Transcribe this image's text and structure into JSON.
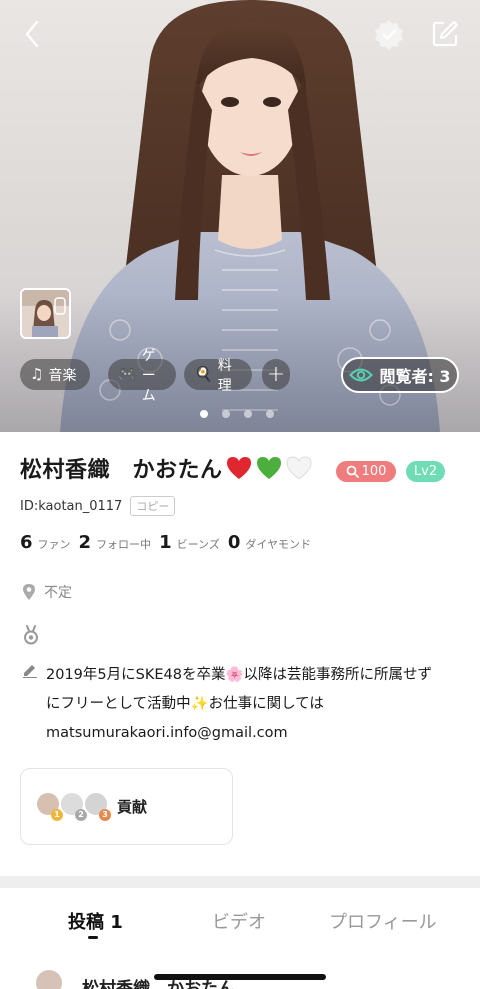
{
  "hero": {
    "tags": [
      {
        "icon": "music-note-icon",
        "glyph": "♫",
        "label": "音楽"
      },
      {
        "icon": "gamepad-icon",
        "glyph": "🎮",
        "label": "ゲーム"
      },
      {
        "icon": "cooking-icon",
        "glyph": "🍳",
        "label": "料理"
      }
    ],
    "add_glyph": "+",
    "viewers_label": "閲覧者: 3",
    "carousel_pages": 4,
    "carousel_active": 1
  },
  "profile": {
    "name": "松村香織　かおたん",
    "badge_count": "100",
    "level": "Lv2",
    "id": "ID:kaotan_0117",
    "copy_label": "コピー",
    "stats": [
      {
        "num": "6",
        "label": "ファン"
      },
      {
        "num": "2",
        "label": "フォロー中"
      },
      {
        "num": "1",
        "label": "ビーンズ"
      },
      {
        "num": "0",
        "label": "ダイヤモンド"
      }
    ],
    "location": "不定",
    "bio_lines": [
      "2019年5月にSKE48を卒業🌸以降は芸能事務所に所属せず",
      "にフリーとして活動中✨お仕事に関しては",
      "matsumurakaori.info@gmail.com"
    ]
  },
  "contribution": {
    "label": "貢献",
    "ranks": [
      "1",
      "2",
      "3"
    ]
  },
  "tabs": {
    "posts": "投稿 1",
    "video": "ビデオ",
    "profile": "プロフィール"
  },
  "post_preview": {
    "name": "松村香織　かおたん"
  },
  "colors": {
    "badge_red": "#f07d7d",
    "badge_green": "#6fdcb6",
    "heart_red": "#e0272f",
    "heart_green": "#4caf3d"
  }
}
